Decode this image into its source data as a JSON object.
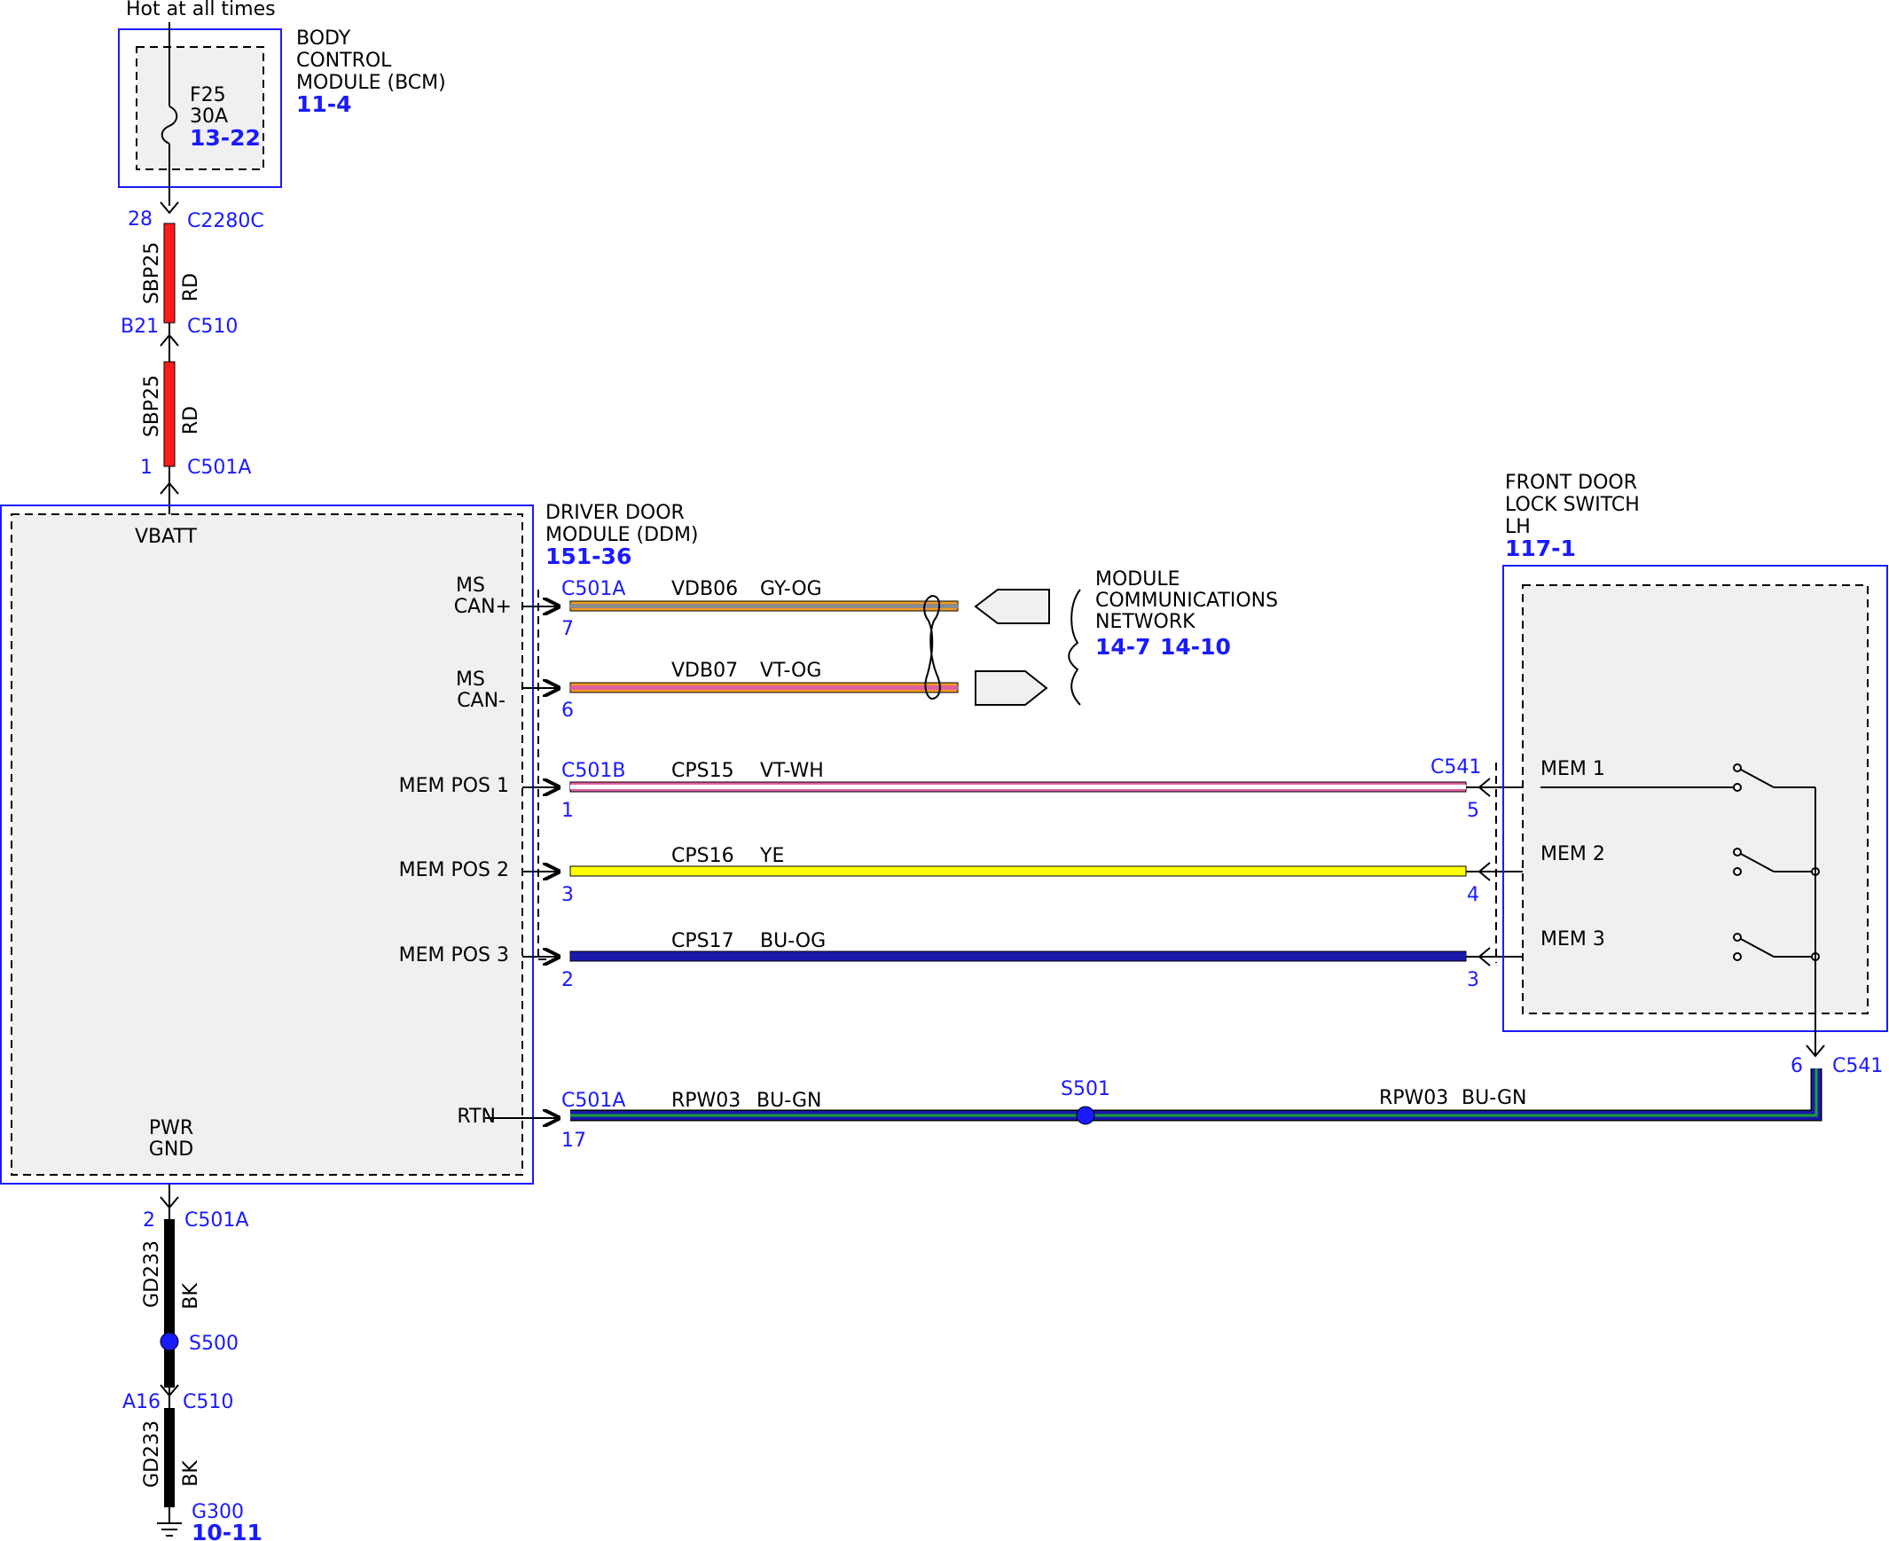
{
  "title": "Hot at all times",
  "colors": {
    "RD": "#ff1a1a",
    "BK": "#000000",
    "GY": "#8c8c8c",
    "OG": "#f29b1c",
    "VT": "#e0609f",
    "WH": "#ffffff",
    "YE": "#ffff00",
    "BU": "#1a1aaa",
    "GN": "#1a9c3a",
    "reference": "#1a1aff"
  },
  "bcm": {
    "name_lines": [
      "BODY",
      "CONTROL",
      "MODULE (BCM)"
    ],
    "ref": "11-4",
    "fuse": {
      "id": "F25",
      "rating": "30A",
      "ref": "13-22"
    }
  },
  "upper_feed": [
    {
      "pin": "28",
      "connector": "C2280C",
      "circuit": "SBP25",
      "color": "RD",
      "pin_below": "B21",
      "connector_below": "C510"
    },
    {
      "circuit": "SBP25",
      "color": "RD",
      "pin_below": "1",
      "connector_below": "C501A"
    }
  ],
  "ddm": {
    "name_lines": [
      "DRIVER DOOR",
      "MODULE (DDM)"
    ],
    "ref": "151-36",
    "vbatt_label": "VBATT",
    "pwr_gnd_lines": [
      "PWR",
      "GND"
    ]
  },
  "network": {
    "name_lines": [
      "MODULE",
      "COMMUNICATIONS",
      "NETWORK"
    ],
    "refs": [
      "14-7",
      "14-10"
    ]
  },
  "switch": {
    "name_lines": [
      "FRONT DOOR",
      "LOCK SWITCH",
      "LH"
    ],
    "ref": "117-1",
    "positions": [
      "MEM 1",
      "MEM 2",
      "MEM 3"
    ],
    "return_pin": "6",
    "return_connector": "C541"
  },
  "signals": [
    {
      "label_lines": [
        "MS",
        "CAN+"
      ],
      "connector": "C501A",
      "pin": "7",
      "circuit": "VDB06",
      "color_code": "GY-OG"
    },
    {
      "label_lines": [
        "MS",
        "CAN-"
      ],
      "pin": "6",
      "circuit": "VDB07",
      "color_code": "VT-OG"
    },
    {
      "label_lines": [
        "MEM POS 1"
      ],
      "connector": "C501B",
      "pin": "1",
      "circuit": "CPS15",
      "color_code": "VT-WH",
      "far_connector": "C541",
      "far_pin": "5"
    },
    {
      "label_lines": [
        "MEM POS 2"
      ],
      "pin": "3",
      "circuit": "CPS16",
      "color_code": "YE",
      "far_pin": "4"
    },
    {
      "label_lines": [
        "MEM POS 3"
      ],
      "pin": "2",
      "circuit": "CPS17",
      "color_code": "BU-OG",
      "far_pin": "3"
    }
  ],
  "rtn": {
    "label": "RTN",
    "connector": "C501A",
    "pin": "17",
    "circuit": "RPW03",
    "color_code": "BU-GN",
    "splice": "S501"
  },
  "ground": [
    {
      "pin": "2",
      "connector": "C501A",
      "circuit": "GD233",
      "color": "BK",
      "splice": "S500"
    },
    {
      "pin": "A16",
      "connector": "C510",
      "circuit": "GD233",
      "color": "BK",
      "ground_id": "G300",
      "ground_ref": "10-11"
    }
  ]
}
